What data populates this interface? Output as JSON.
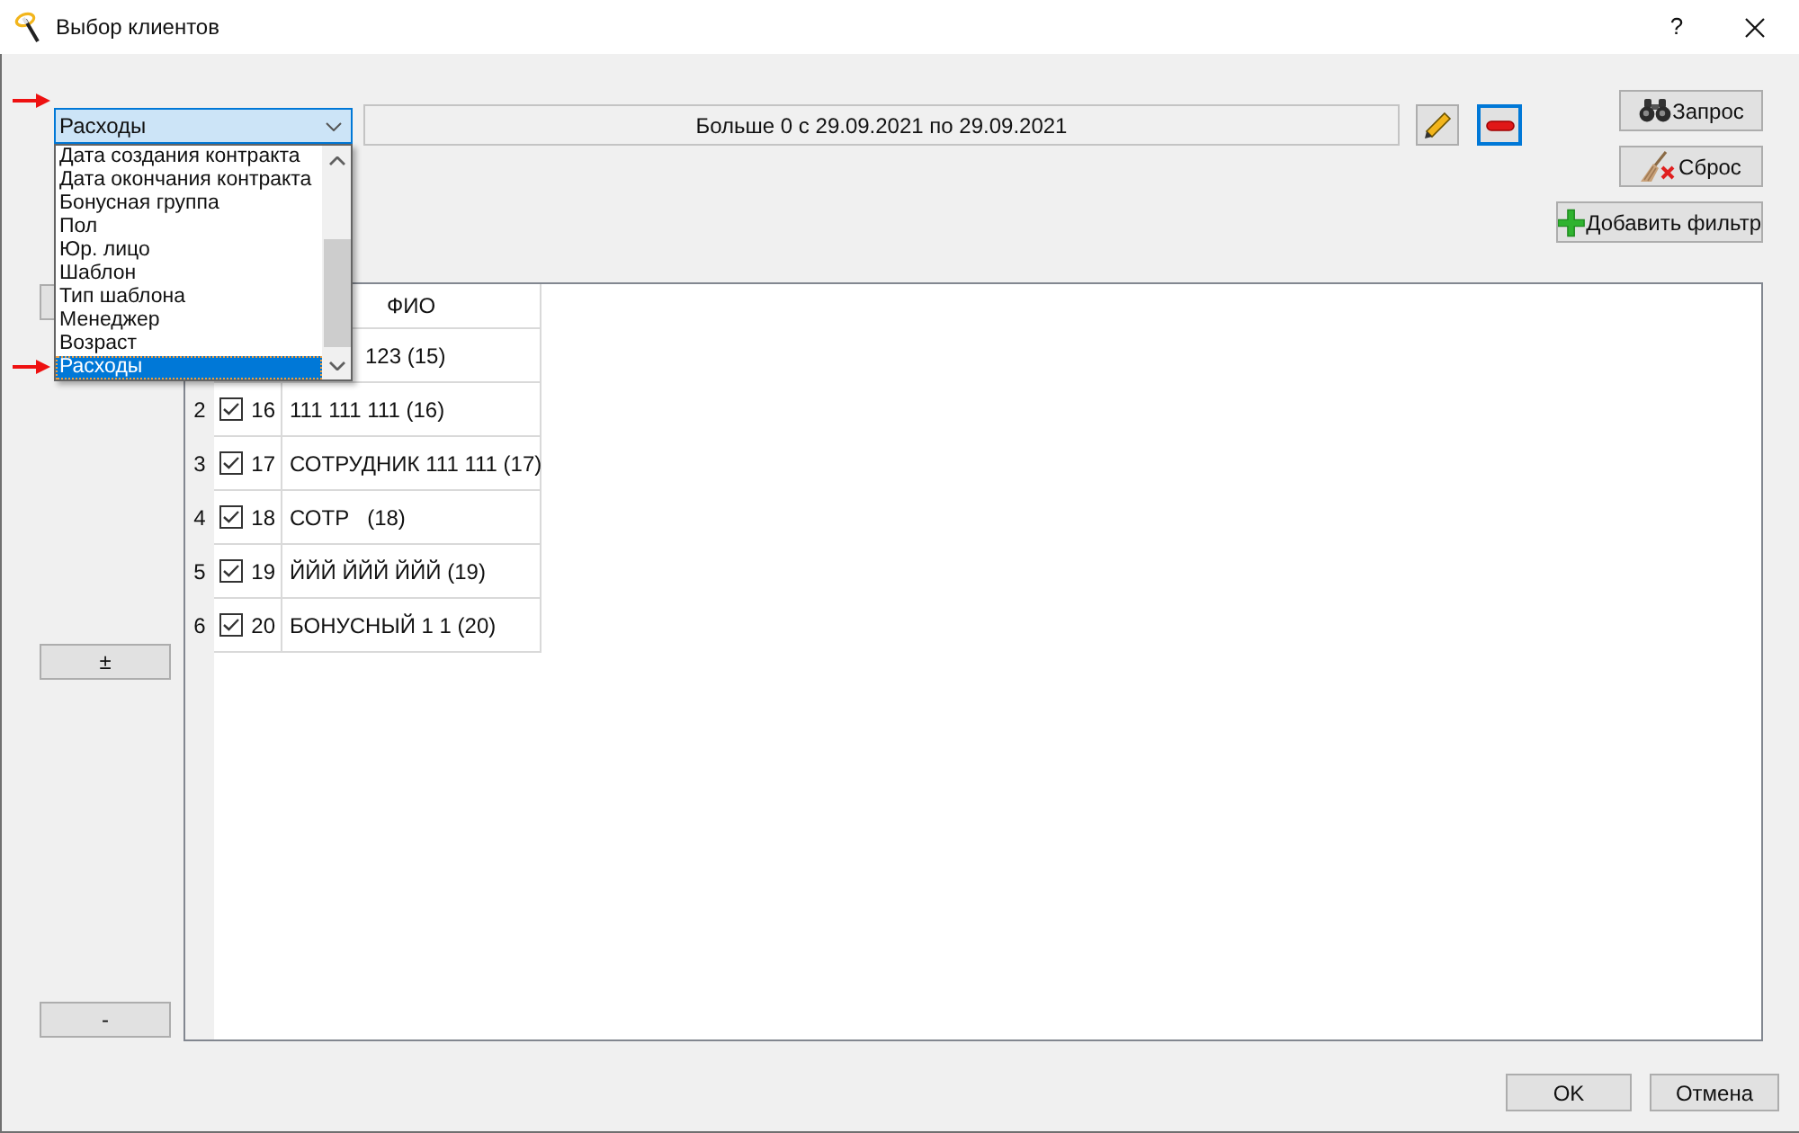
{
  "window": {
    "title": "Выбор клиентов",
    "help": "?"
  },
  "filter": {
    "field": "Расходы",
    "expanded": true,
    "options": [
      {
        "label": "Дата создания контракта",
        "selected": false
      },
      {
        "label": "Дата окончания контракта",
        "selected": false
      },
      {
        "label": "Бонусная группа",
        "selected": false
      },
      {
        "label": "Пол",
        "selected": false
      },
      {
        "label": "Юр. лицо",
        "selected": false
      },
      {
        "label": "Шаблон",
        "selected": false
      },
      {
        "label": "Тип шаблона",
        "selected": false
      },
      {
        "label": "Менеджер",
        "selected": false
      },
      {
        "label": "Возраст",
        "selected": false
      },
      {
        "label": "Расходы",
        "selected": true
      }
    ],
    "condition": "Больше 0 с 29.09.2021 по 29.09.2021"
  },
  "actions": [
    {
      "kind": "query",
      "label": "Запрос"
    },
    {
      "kind": "reset",
      "label": "Сброс"
    },
    {
      "kind": "add",
      "label": "Добавить фильтр"
    }
  ],
  "side_buttons": [
    "±",
    "-"
  ],
  "table": {
    "header": "ФИО",
    "rows": [
      {
        "name": "123 (15)"
      },
      {
        "number": "2",
        "checked": true,
        "id": "16",
        "name": "111 111 111 (16)"
      },
      {
        "number": "3",
        "checked": true,
        "id": "17",
        "name": "СОТРУДНИК 111 111 (17)"
      },
      {
        "number": "4",
        "checked": true,
        "id": "18",
        "name": "СОТР   (18)"
      },
      {
        "number": "5",
        "checked": true,
        "id": "19",
        "name": "ЙЙЙ ЙЙЙ ЙЙЙ (19)"
      },
      {
        "number": "6",
        "checked": true,
        "id": "20",
        "name": "БОНУСНЫЙ 1 1 (20)"
      }
    ]
  },
  "buttons": [
    "OK",
    "Отмена"
  ]
}
